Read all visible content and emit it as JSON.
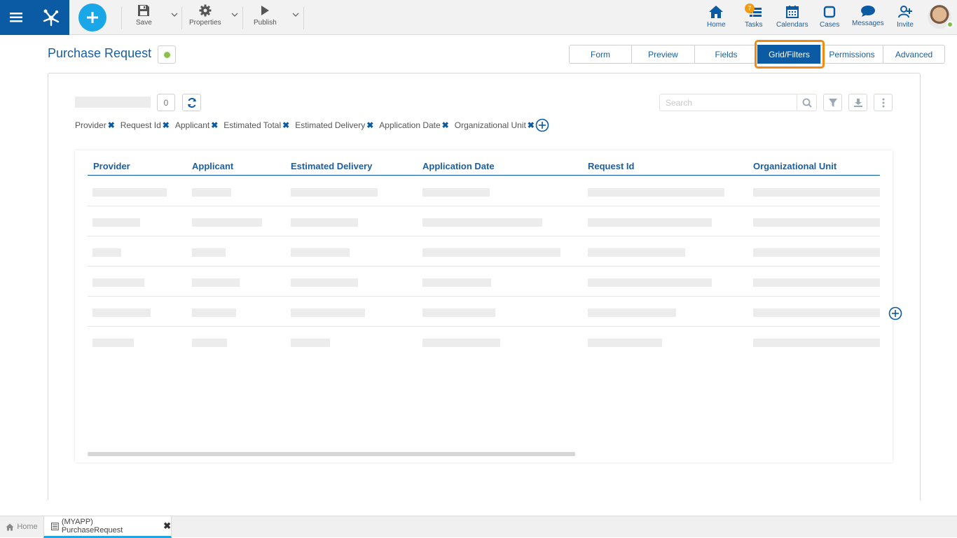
{
  "toolbar": {
    "save_label": "Save",
    "properties_label": "Properties",
    "publish_label": "Publish"
  },
  "nav": {
    "home_label": "Home",
    "tasks_label": "Tasks",
    "tasks_badge": "7",
    "calendars_label": "Calendars",
    "cases_label": "Cases",
    "messages_label": "Messages",
    "invite_label": "Invite"
  },
  "page": {
    "title": "Purchase Request",
    "status_color": "#8bc34a"
  },
  "tabs": [
    {
      "label": "Form",
      "active": false
    },
    {
      "label": "Preview",
      "active": false
    },
    {
      "label": "Fields",
      "active": false
    },
    {
      "label": "Grid/Filters",
      "active": true
    },
    {
      "label": "Permissions",
      "active": false
    },
    {
      "label": "Advanced",
      "active": false
    }
  ],
  "grid_tools": {
    "count": "0",
    "search_placeholder": "Search"
  },
  "filters": [
    "Provider",
    "Request Id",
    "Applicant",
    "Estimated Total",
    "Estimated Delivery",
    "Application Date",
    "Organizational Unit"
  ],
  "grid": {
    "columns": [
      "Provider",
      "Applicant",
      "Estimated Delivery",
      "Application Date",
      "Request Id",
      "Organizational Unit"
    ],
    "row_count": 6
  },
  "bottom_tabs": {
    "home_label": "Home",
    "doc_label": "(MYAPP) PurchaseRequest"
  },
  "colors": {
    "brand": "#0b5aa4",
    "accent": "#1aa7e8",
    "highlight": "#f08a13"
  }
}
